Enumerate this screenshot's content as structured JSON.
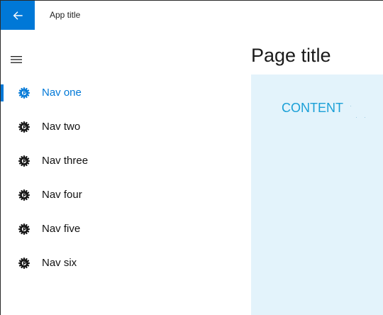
{
  "app": {
    "title": "App title",
    "back_icon": "back-arrow-icon",
    "accent_color": "#0078d7"
  },
  "pane": {
    "menu_icon": "hamburger-icon",
    "items": [
      {
        "label": "Nav one",
        "icon": "gear-icon",
        "selected": true
      },
      {
        "label": "Nav two",
        "icon": "gear-icon",
        "selected": false
      },
      {
        "label": "Nav three",
        "icon": "gear-icon",
        "selected": false
      },
      {
        "label": "Nav four",
        "icon": "gear-icon",
        "selected": false
      },
      {
        "label": "Nav five",
        "icon": "gear-icon",
        "selected": false
      },
      {
        "label": "Nav six",
        "icon": "gear-icon",
        "selected": false
      }
    ]
  },
  "main": {
    "page_title": "Page title",
    "content_label": "CONTENT",
    "content_bg": "#e3f3fb",
    "content_text_color": "#1aa0d7"
  }
}
